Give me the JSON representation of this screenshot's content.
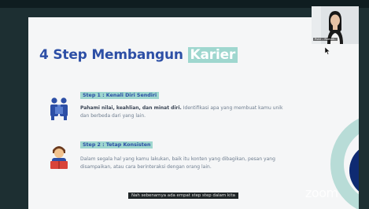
{
  "meeting": {
    "participant_name": "Putri – Rumah..",
    "watermark": "zoom",
    "caption": "Nah sebenarnya ada empat step step dalam kita"
  },
  "slide": {
    "title_part1": "4 Step Membangun ",
    "title_highlight": "Karier",
    "step1": {
      "heading": "Step 1 : Kenali Diri Sendiri",
      "body_bold": "Pahami nilai, keahlian, dan minat diri.",
      "body_rest": " Identifikasi apa yang membuat kamu unik dan berbeda dari yang lain."
    },
    "step2": {
      "heading": "Step 2 : Tetap Konsisten",
      "body": "Dalam segala hal yang kamu lakukan, baik itu konten yang dibagikan, pesan yang disampaikan, atau cara berinteraksi dengan orang lain."
    }
  },
  "colors": {
    "title_blue": "#2d4fa6",
    "highlight_teal": "#9fd7cf",
    "navy": "#0e2a72",
    "background": "#1d2f32"
  },
  "icons": {
    "step1": "people-puzzle-icon",
    "step2": "person-reading-icon",
    "cursor": "mouse-pointer-icon"
  }
}
